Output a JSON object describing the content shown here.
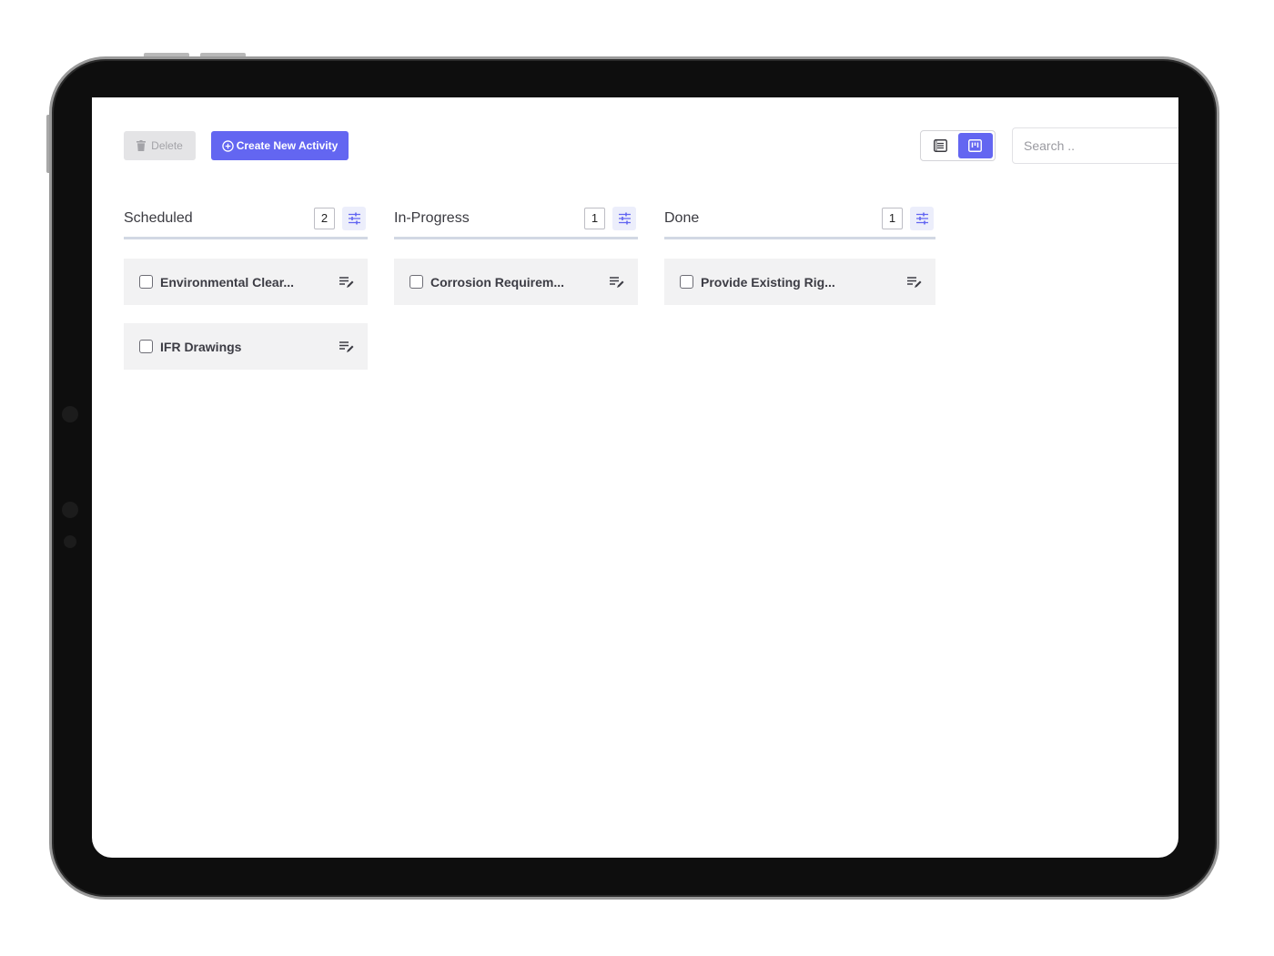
{
  "toolbar": {
    "delete_label": "Delete",
    "create_label": "Create New Activity",
    "search_placeholder": "Search .."
  },
  "view_toggle": {
    "options": [
      {
        "icon": "list-view-icon",
        "active": false
      },
      {
        "icon": "board-view-icon",
        "active": true
      }
    ]
  },
  "columns": [
    {
      "title": "Scheduled",
      "count": "2",
      "cards": [
        {
          "title": "Environmental Clear..."
        },
        {
          "title": "IFR Drawings"
        }
      ]
    },
    {
      "title": "In-Progress",
      "count": "1",
      "cards": [
        {
          "title": "Corrosion Requirem..."
        }
      ]
    },
    {
      "title": "Done",
      "count": "1",
      "cards": [
        {
          "title": "Provide Existing Rig..."
        }
      ]
    }
  ],
  "colors": {
    "accent": "#6366f1",
    "card_bg": "#f2f2f3",
    "disabled_bg": "#e4e4e6",
    "column_divider": "#d2d8e4"
  }
}
